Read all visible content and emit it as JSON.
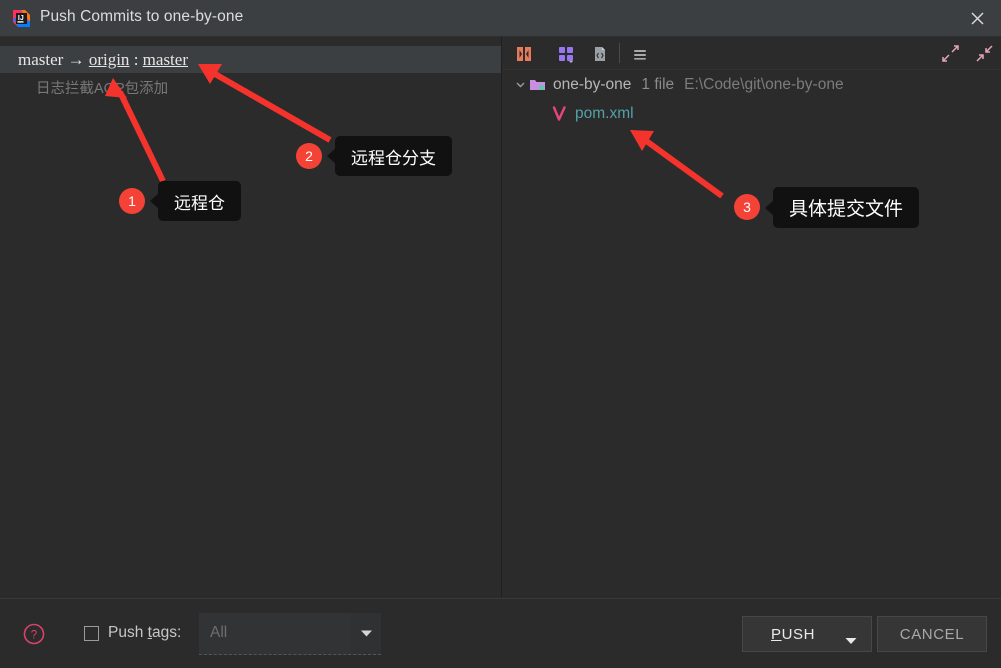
{
  "window": {
    "title": "Push Commits to one-by-one",
    "app_icon": "intellij-idea-icon",
    "close_icon": "close-icon"
  },
  "left_panel": {
    "commit_node": {
      "local_branch": "master",
      "arrow": "→",
      "remote": "origin",
      "separator": ":",
      "remote_branch": "master"
    },
    "commit_message": "日志拦截AOP包添加"
  },
  "right_panel": {
    "toolbar": {
      "buttons": [
        {
          "name": "show-diff-icon",
          "title": "Show Diff"
        },
        {
          "name": "group-by-icon",
          "title": "Group By"
        },
        {
          "name": "preview-diff-icon",
          "title": "Preview Diff"
        },
        {
          "name": "options-menu-icon",
          "title": "Options"
        }
      ],
      "expand_all_icon": "expand-all-icon",
      "collapse_all_icon": "collapse-all-icon"
    },
    "tree": {
      "directory": {
        "chevron": "chevron-down-icon",
        "icon": "folder-icon",
        "name": "one-by-one",
        "file_count": "1 file",
        "path": "E:\\Code\\git\\one-by-one"
      },
      "files": [
        {
          "icon": "maven-file-icon",
          "name": "pom.xml"
        }
      ]
    }
  },
  "bottom_bar": {
    "help_icon": "help-icon",
    "push_tags_checkbox_checked": false,
    "push_tags_label_prefix": "Push ",
    "push_tags_label_mnemonic": "t",
    "push_tags_label_suffix": "ags:",
    "tags_combo_value": "All",
    "tags_combo_arrow_icon": "chevron-down-icon",
    "push_button_mnemonic": "P",
    "push_button_rest": "USH",
    "push_button_arrow_icon": "chevron-down-icon",
    "cancel_button_label": "CANCEL"
  },
  "annotations": [
    {
      "number": "1",
      "text": "远程仓"
    },
    {
      "number": "2",
      "text": "远程仓分支"
    },
    {
      "number": "3",
      "text": "具体提交文件"
    }
  ],
  "colors": {
    "background": "#2b2b2b",
    "titlebar": "#3c3f41",
    "selection": "#3c3f41",
    "annotation_red": "#f44336",
    "file_link": "#53a1a8",
    "maven_pink": "#e8457a"
  }
}
